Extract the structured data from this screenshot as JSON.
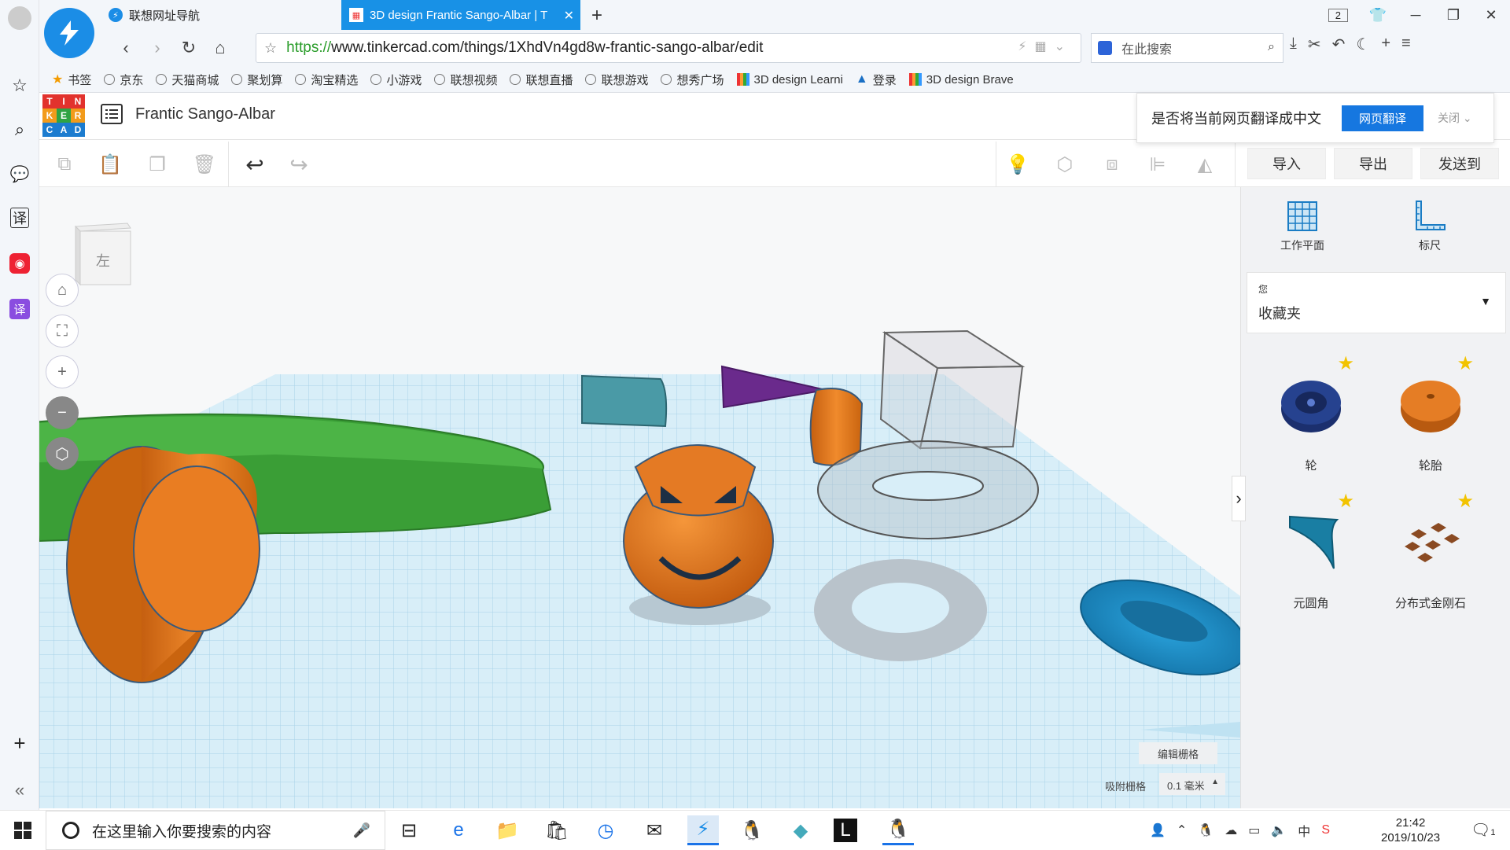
{
  "browser": {
    "tabs": [
      {
        "label": "联想网址导航"
      },
      {
        "label": "3D design Frantic Sango-Albar | T"
      }
    ],
    "address": {
      "scheme": "https://",
      "url": "www.tinkercad.com/things/1XhdVn4gd8w-frantic-sango-albar/edit"
    },
    "search_placeholder": "在此搜索",
    "tab_count": "2",
    "bookmarks": [
      "书签",
      "京东",
      "天猫商城",
      "聚划算",
      "淘宝精选",
      "小游戏",
      "联想视频",
      "联想直播",
      "联想游戏",
      "想秀广场",
      "3D design Learni",
      "登录",
      "3D design Brave"
    ]
  },
  "translate_bar": {
    "prompt": "是否将当前网页翻译成中文",
    "translate": "网页翻译",
    "close": "关闭"
  },
  "app": {
    "logo_letters": [
      "T",
      "I",
      "N",
      "K",
      "E",
      "R",
      "C",
      "A",
      "D"
    ],
    "design_title": "Frantic Sango-Albar",
    "actions": {
      "import": "导入",
      "export": "导出",
      "send_to": "发送到"
    },
    "viewcube_face": "左",
    "edit_grid": "编辑栅格",
    "snap_label": "吸附栅格",
    "snap_value": "0.1 毫米"
  },
  "side_panel": {
    "workplane": "工作平面",
    "ruler": "标尺",
    "library_owner": "您",
    "library_name": "收藏夹",
    "shapes": [
      {
        "label": "轮"
      },
      {
        "label": "轮胎"
      },
      {
        "label": "元圆角"
      },
      {
        "label": "分布式金刚石"
      }
    ]
  },
  "taskbar": {
    "search_placeholder": "在这里输入你要搜索的内容",
    "time": "21:42",
    "date": "2019/10/23",
    "ime": "中",
    "notif_count": "1"
  },
  "colors": {
    "accent": "#1891e6",
    "shape_orange": "#e3781e",
    "shape_green": "#3a9e36",
    "shape_teal": "#4a9aa6",
    "shape_blue": "#1a86c4",
    "shape_purple": "#6a2a8c"
  }
}
